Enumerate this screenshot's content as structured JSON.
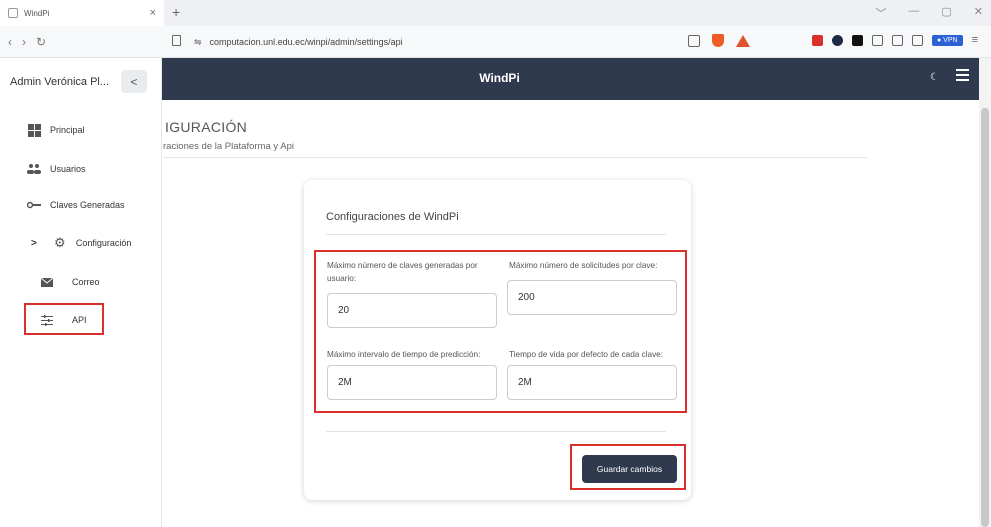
{
  "browser": {
    "tab_title": "WindPi",
    "tab_close": "×",
    "new_tab": "+",
    "url": "computacion.unl.edu.ec/winpi/admin/settings/api",
    "vpn_label": "● VPN",
    "window_controls": [
      "﹀",
      "—",
      "▢",
      "✕"
    ]
  },
  "sidebar": {
    "user_name": "Admin Verónica Pl...",
    "collapse_symbol": "<",
    "items": [
      {
        "label": "Principal",
        "icon": "grid-icon"
      },
      {
        "label": "Usuarios",
        "icon": "users-icon"
      },
      {
        "label": "Claves Generadas",
        "icon": "key-icon"
      },
      {
        "label": "Configuración",
        "icon": "gear-icon",
        "chevron": ">"
      },
      {
        "label": "Correo",
        "icon": "mail-icon"
      },
      {
        "label": "API",
        "icon": "sliders-icon"
      }
    ]
  },
  "navbar": {
    "brand": "WindPi",
    "theme_symbol": "☾"
  },
  "page": {
    "title": "IGURACIÓN",
    "subtitle": "raciones de la Plataforma y Api"
  },
  "card": {
    "title": "Configuraciones de WindPi",
    "fields": [
      {
        "label": "Máximo número de claves generadas por usuario:",
        "value": "20"
      },
      {
        "label": "Máximo número de solicitudes por clave:",
        "value": "200"
      },
      {
        "label": "Máximo intervalo de tiempo de predicción:",
        "value": "2M"
      },
      {
        "label": "Tiempo de vida por defecto de cada clave:",
        "value": "2M"
      }
    ],
    "save_label": "Guardar cambios"
  },
  "colors": {
    "navbar_bg": "#2f3a4f",
    "highlight_red": "#d9302c",
    "button_bg": "#2f3a4f"
  }
}
